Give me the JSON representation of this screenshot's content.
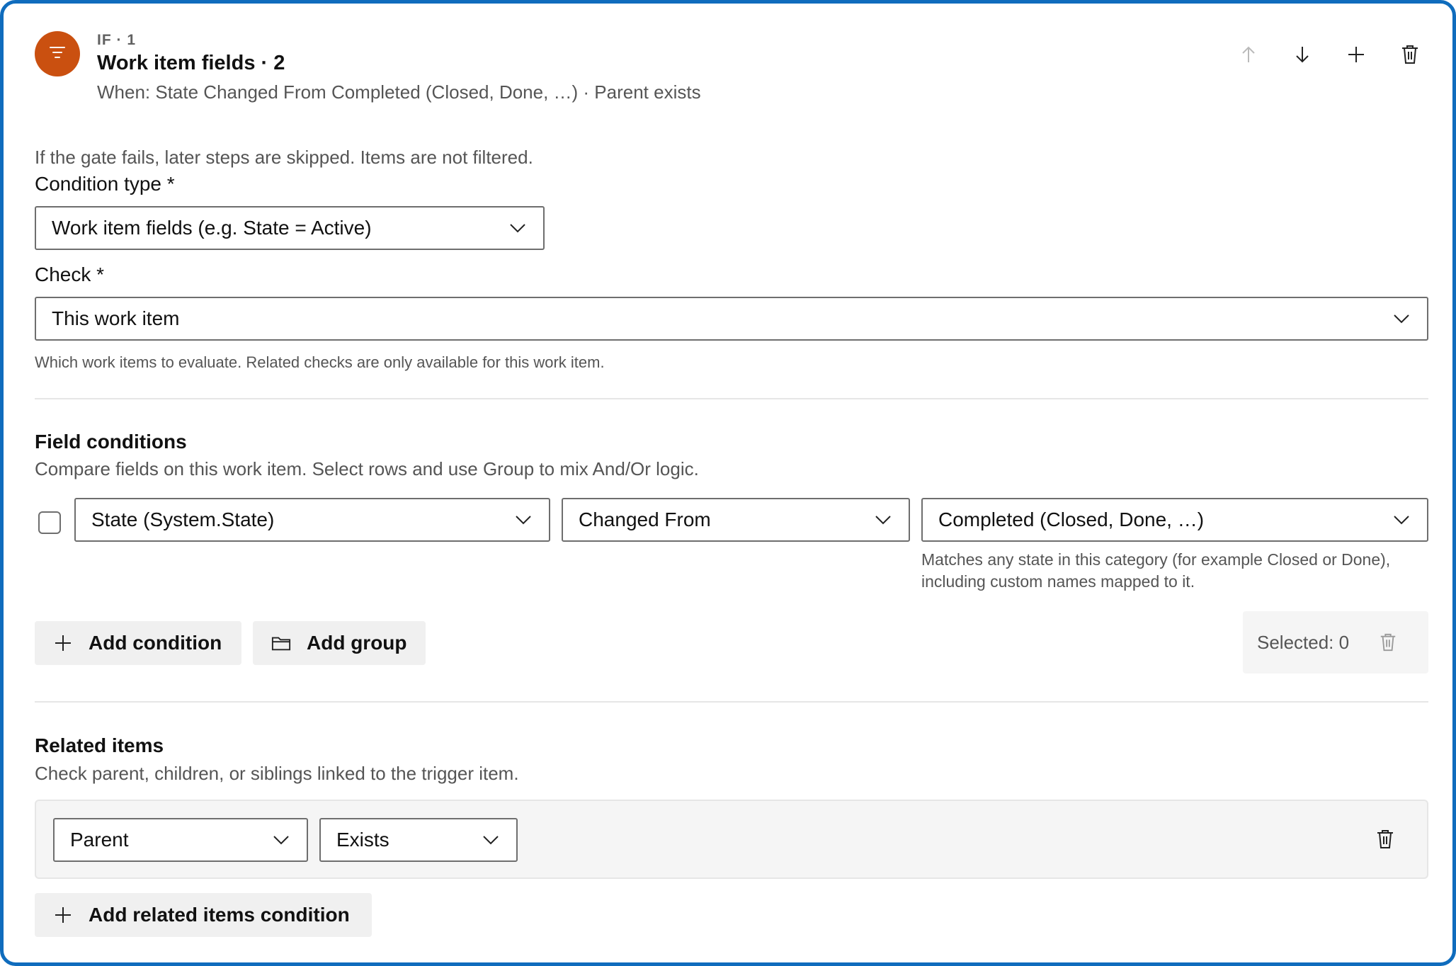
{
  "header": {
    "badge_icon": "filter-icon",
    "badge_color": "#ca5010",
    "eyebrow": "IF · 1",
    "title": "Work item fields · 2",
    "subtitle": "When: State Changed From Completed (Closed, Done, …) · Parent exists",
    "actions": [
      "arrow-up-icon",
      "arrow-down-icon",
      "plus-icon",
      "trash-icon"
    ]
  },
  "gate_note": "If the gate fails, later steps are skipped. Items are not filtered.",
  "condition_type": {
    "label": "Condition type *",
    "value": "Work item fields (e.g. State = Active)"
  },
  "check": {
    "label": "Check *",
    "value": "This work item",
    "help": "Which work items to evaluate. Related checks are only available for this work item."
  },
  "field_conditions": {
    "title": "Field conditions",
    "description": "Compare fields on this work item. Select rows and use Group to mix And/Or logic.",
    "rows": [
      {
        "checked": false,
        "field": "State (System.State)",
        "operator": "Changed From",
        "value": "Completed (Closed, Done, …)",
        "value_help": "Matches any state in this category (for example Closed or Done), including custom names mapped to it."
      }
    ],
    "add_condition_label": "Add condition",
    "add_group_label": "Add group",
    "selected_label": "Selected: 0"
  },
  "related_items": {
    "title": "Related items",
    "description": "Check parent, children, or siblings linked to the trigger item.",
    "rows": [
      {
        "relation": "Parent",
        "check": "Exists"
      }
    ],
    "add_label": "Add related items condition"
  },
  "colors": {
    "accent_border": "#0f6cbd",
    "badge": "#ca5010"
  }
}
